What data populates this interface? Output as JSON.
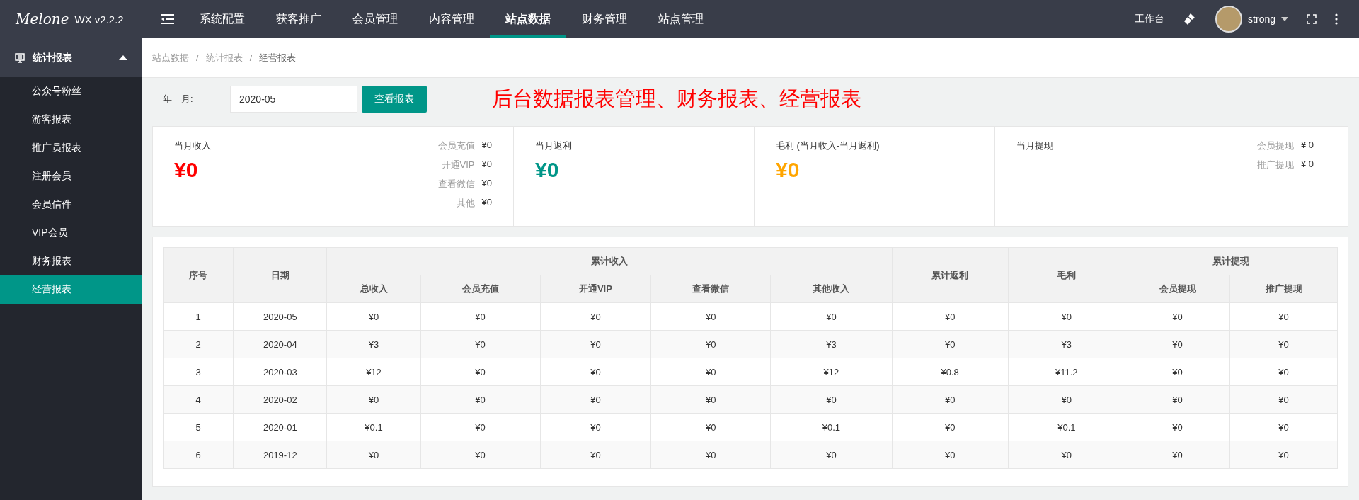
{
  "logo": {
    "script": "Melone",
    "version": "WX v2.2.2"
  },
  "top_menu": [
    {
      "label": "系统配置",
      "selected": false
    },
    {
      "label": "获客推广",
      "selected": false
    },
    {
      "label": "会员管理",
      "selected": false
    },
    {
      "label": "内容管理",
      "selected": false
    },
    {
      "label": "站点数据",
      "selected": true
    },
    {
      "label": "财务管理",
      "selected": false
    },
    {
      "label": "站点管理",
      "selected": false
    }
  ],
  "top_right": {
    "workbench": "工作台",
    "username": "strong"
  },
  "sidebar": {
    "group": {
      "label": "统计报表",
      "expanded": true
    },
    "items": [
      {
        "label": "公众号粉丝",
        "selected": false
      },
      {
        "label": "游客报表",
        "selected": false
      },
      {
        "label": "推广员报表",
        "selected": false
      },
      {
        "label": "注册会员",
        "selected": false
      },
      {
        "label": "会员信件",
        "selected": false
      },
      {
        "label": "VIP会员",
        "selected": false
      },
      {
        "label": "财务报表",
        "selected": false
      },
      {
        "label": "经营报表",
        "selected": true
      }
    ]
  },
  "breadcrumb": [
    {
      "label": "站点数据",
      "separator": "/"
    },
    {
      "label": "统计报表",
      "separator": "/"
    },
    {
      "label": "经营报表"
    }
  ],
  "filter": {
    "label": "年　月:",
    "value": "2020-05",
    "button": "查看报表"
  },
  "annotation": "后台数据报表管理、财务报表、经营报表",
  "cards": [
    {
      "title": "当月收入",
      "amount": "¥0",
      "color": "#ff0000",
      "details": [
        {
          "label": "会员充值",
          "value": "¥0"
        },
        {
          "label": "开通VIP",
          "value": "¥0"
        },
        {
          "label": "查看微信",
          "value": "¥0"
        },
        {
          "label": "其他",
          "value": "¥0"
        }
      ]
    },
    {
      "title": "当月返利",
      "amount": "¥0",
      "color": "#009688"
    },
    {
      "title": "毛利 (当月收入-当月返利)",
      "amount": "¥0",
      "color": "#ffa500"
    },
    {
      "title": "当月提现",
      "details": [
        {
          "label": "会员提现",
          "value": "¥ 0"
        },
        {
          "label": "推广提现",
          "value": "¥ 0"
        }
      ]
    }
  ],
  "table": {
    "header_groups": [
      {
        "label": "序号"
      },
      {
        "label": "日期"
      },
      {
        "label": "累计收入",
        "children": [
          {
            "label": "总收入"
          },
          {
            "label": "会员充值"
          },
          {
            "label": "开通VIP"
          },
          {
            "label": "查看微信"
          },
          {
            "label": "其他收入"
          }
        ]
      },
      {
        "label": "累计返利"
      },
      {
        "label": "毛利"
      },
      {
        "label": "累计提现",
        "children": [
          {
            "label": "会员提现"
          },
          {
            "label": "推广提现"
          }
        ]
      }
    ],
    "rows": [
      [
        "1",
        "2020-05",
        "¥0",
        "¥0",
        "¥0",
        "¥0",
        "¥0",
        "¥0",
        "¥0",
        "¥0",
        "¥0"
      ],
      [
        "2",
        "2020-04",
        "¥3",
        "¥0",
        "¥0",
        "¥0",
        "¥3",
        "¥0",
        "¥3",
        "¥0",
        "¥0"
      ],
      [
        "3",
        "2020-03",
        "¥12",
        "¥0",
        "¥0",
        "¥0",
        "¥12",
        "¥0.8",
        "¥11.2",
        "¥0",
        "¥0"
      ],
      [
        "4",
        "2020-02",
        "¥0",
        "¥0",
        "¥0",
        "¥0",
        "¥0",
        "¥0",
        "¥0",
        "¥0",
        "¥0"
      ],
      [
        "5",
        "2020-01",
        "¥0.1",
        "¥0",
        "¥0",
        "¥0",
        "¥0.1",
        "¥0",
        "¥0.1",
        "¥0",
        "¥0"
      ],
      [
        "6",
        "2019-12",
        "¥0",
        "¥0",
        "¥0",
        "¥0",
        "¥0",
        "¥0",
        "¥0",
        "¥0",
        "¥0"
      ]
    ]
  }
}
